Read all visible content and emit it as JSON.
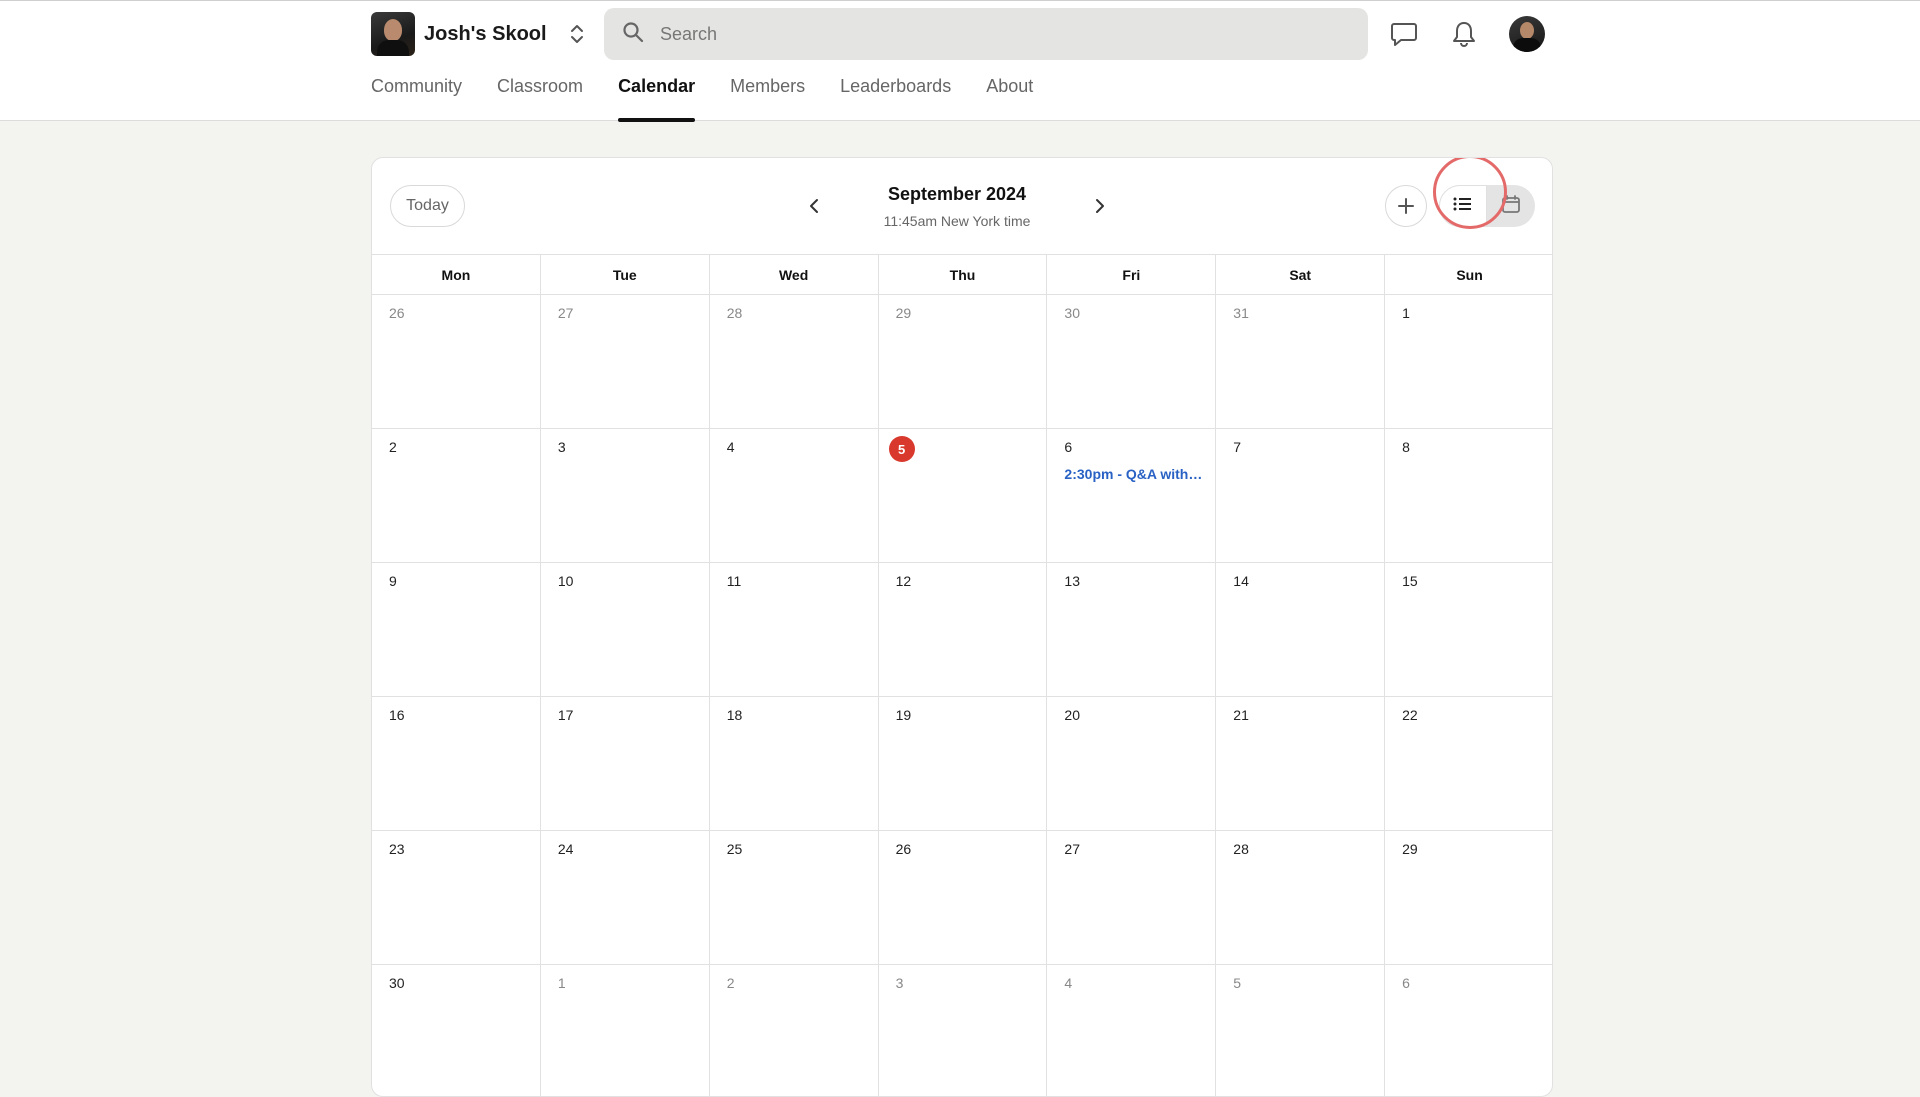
{
  "header": {
    "community_name": "Josh's Skool",
    "search_placeholder": "Search",
    "icons": {
      "switch": "chevron-up-down-icon",
      "search": "search-icon",
      "chat": "chat-icon",
      "notifications": "bell-icon"
    }
  },
  "nav": {
    "tabs": [
      {
        "label": "Community"
      },
      {
        "label": "Classroom"
      },
      {
        "label": "Calendar",
        "active": true
      },
      {
        "label": "Members"
      },
      {
        "label": "Leaderboards"
      },
      {
        "label": "About"
      }
    ]
  },
  "calendar": {
    "today_label": "Today",
    "month_title": "September 2024",
    "time_subtitle": "11:45am New York time",
    "weekdays": [
      "Mon",
      "Tue",
      "Wed",
      "Thu",
      "Fri",
      "Sat",
      "Sun"
    ],
    "weeks": [
      [
        {
          "n": "26",
          "other": true
        },
        {
          "n": "27",
          "other": true
        },
        {
          "n": "28",
          "other": true
        },
        {
          "n": "29",
          "other": true
        },
        {
          "n": "30",
          "other": true
        },
        {
          "n": "31",
          "other": true
        },
        {
          "n": "1"
        }
      ],
      [
        {
          "n": "2"
        },
        {
          "n": "3"
        },
        {
          "n": "4"
        },
        {
          "n": "5",
          "today": true
        },
        {
          "n": "6",
          "event": "2:30pm - Q&A with…"
        },
        {
          "n": "7"
        },
        {
          "n": "8"
        }
      ],
      [
        {
          "n": "9"
        },
        {
          "n": "10"
        },
        {
          "n": "11"
        },
        {
          "n": "12"
        },
        {
          "n": "13"
        },
        {
          "n": "14"
        },
        {
          "n": "15"
        }
      ],
      [
        {
          "n": "16"
        },
        {
          "n": "17"
        },
        {
          "n": "18"
        },
        {
          "n": "19"
        },
        {
          "n": "20"
        },
        {
          "n": "21"
        },
        {
          "n": "22"
        }
      ],
      [
        {
          "n": "23"
        },
        {
          "n": "24"
        },
        {
          "n": "25"
        },
        {
          "n": "26"
        },
        {
          "n": "27"
        },
        {
          "n": "28"
        },
        {
          "n": "29"
        }
      ],
      [
        {
          "n": "30"
        },
        {
          "n": "1",
          "other": true
        },
        {
          "n": "2",
          "other": true
        },
        {
          "n": "3",
          "other": true
        },
        {
          "n": "4",
          "other": true
        },
        {
          "n": "5",
          "other": true
        },
        {
          "n": "6",
          "other": true
        }
      ]
    ],
    "colors": {
      "today_badge": "#d9382c",
      "event_text": "#2962c4",
      "click_ring": "#e46a6a"
    }
  }
}
